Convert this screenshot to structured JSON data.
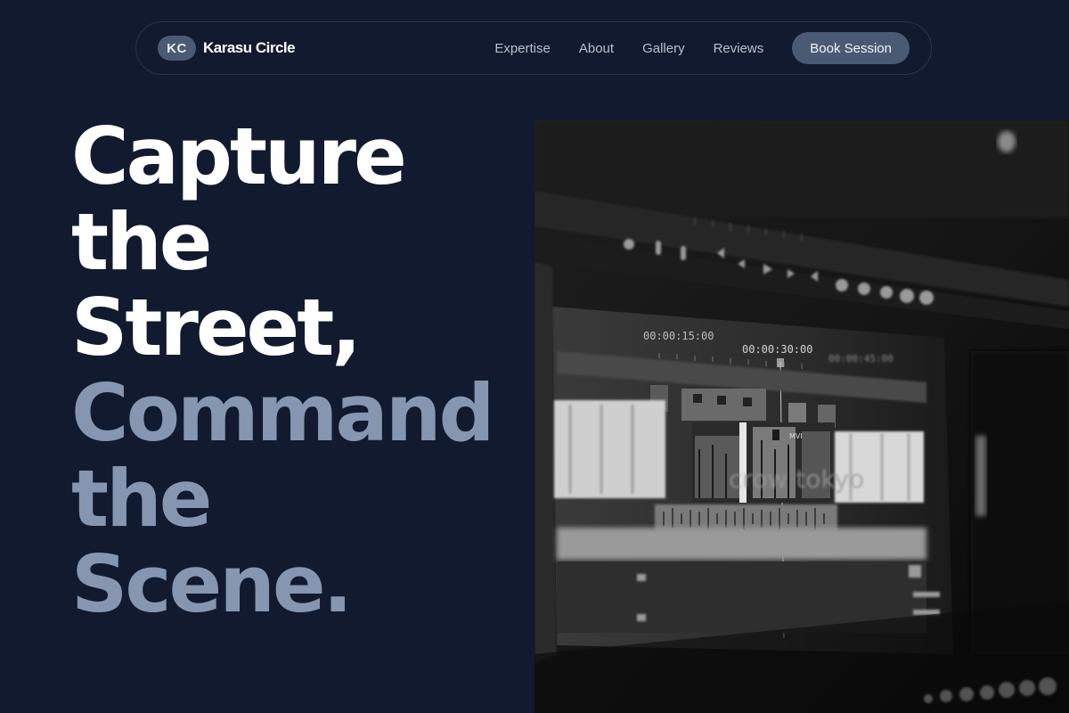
{
  "brand": {
    "logo_text": "KC",
    "name": "Karasu Circle"
  },
  "nav": {
    "links": [
      "Expertise",
      "About",
      "Gallery",
      "Reviews"
    ],
    "cta_label": "Book Session"
  },
  "hero": {
    "lines": [
      "Capture",
      "the",
      "Street,",
      "Command",
      "the",
      "Scene."
    ],
    "colors": {
      "primary": "#ffffff",
      "muted": "#8696b0"
    }
  },
  "image": {
    "timecode_a": "00:00:15:00",
    "timecode_b": "00:00:30:00",
    "timecode_c": "00:00:45:00",
    "clip_tag": "MVI",
    "overlay_text": "crow tokyo"
  },
  "colors": {
    "background": "#111a2e",
    "nav_border": "#2a344b",
    "accent_button": "#4b5a74",
    "nav_text": "#b9c1cf"
  }
}
